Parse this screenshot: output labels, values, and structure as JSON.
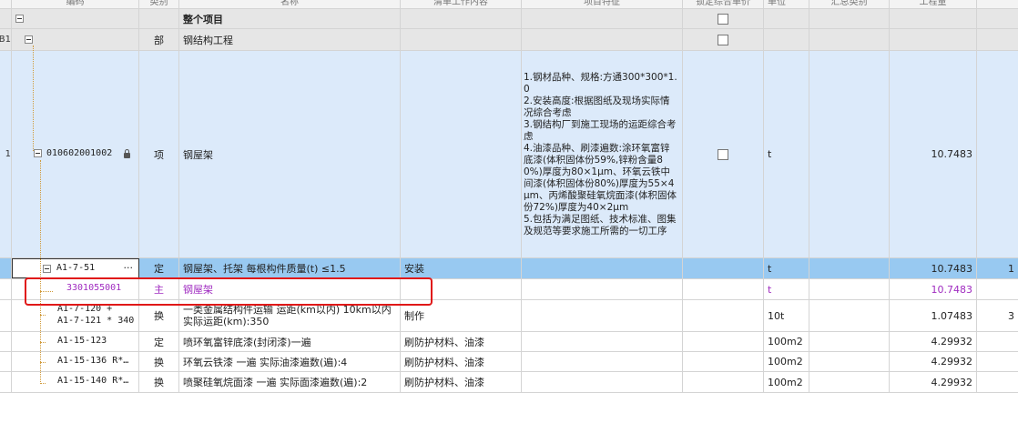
{
  "header": {
    "code": "编码",
    "type": "类别",
    "name": "名称",
    "content": "清单工作内容",
    "feature": "项目特征",
    "lock": "锁定综合单价",
    "unit": "单位",
    "spec": "汇总类别",
    "qty": "工程量"
  },
  "rows": [
    {
      "num": "",
      "code": "",
      "type": "",
      "name": "整个项目",
      "content": "",
      "feature": "",
      "unit": "",
      "qty": ""
    },
    {
      "num": "B1",
      "code": "",
      "type": "部",
      "name": "钢结构工程",
      "content": "",
      "feature": "",
      "unit": "",
      "qty": ""
    },
    {
      "num": "1",
      "code": "010602001002",
      "type": "项",
      "name": "钢屋架",
      "content": "",
      "feature": "1.钢材品种、规格:方通300*300*1.0\n2.安装高度:根据图纸及现场实际情况综合考虑\n3.钢结构厂到施工现场的运距综合考虑\n4.油漆品种、刷漆遍数:涂环氧富锌底漆(体积固体份59%,锌粉含量80%)厚度为80×1μm、环氧云铁中间漆(体积固体份80%)厚度为55×4μm、丙烯酸聚硅氧烷面漆(体积固体份72%)厚度为40×2μm\n5.包括为满足图纸、技术标准、图集及规范等要求施工所需的一切工序",
      "unit": "t",
      "qty": "10.7483"
    },
    {
      "num": "",
      "code": "A1-7-51",
      "type": "定",
      "name": "钢屋架、托架 每根构件质量(t) ≤1.5",
      "content": "安装",
      "feature": "",
      "unit": "t",
      "qty": "10.7483",
      "extra": "1"
    },
    {
      "num": "",
      "code": "3301055001",
      "type": "主",
      "name": "钢屋架",
      "content": "",
      "feature": "",
      "unit": "t",
      "qty": "10.7483"
    },
    {
      "num": "",
      "code": "A1-7-120 +\nA1-7-121 * 340",
      "type": "换",
      "name": "一类金属结构件运输 运距(km以内) 10km以内 实际运距(km):350",
      "content": "制作",
      "feature": "",
      "unit": "10t",
      "qty": "1.07483",
      "extra": "3"
    },
    {
      "num": "",
      "code": "A1-15-123",
      "type": "定",
      "name": "喷环氧富锌底漆(封闭漆)一遍",
      "content": "刷防护材料、油漆",
      "feature": "",
      "unit": "100m2",
      "qty": "4.29932"
    },
    {
      "num": "",
      "code": "A1-15-136 R*…",
      "type": "换",
      "name": "环氧云铁漆 一遍  实际油漆遍数(遍):4",
      "content": "刷防护材料、油漆",
      "feature": "",
      "unit": "100m2",
      "qty": "4.29932"
    },
    {
      "num": "",
      "code": "A1-15-140 R*…",
      "type": "换",
      "name": "喷聚硅氧烷面漆 一遍  实际面漆遍数(遍):2",
      "content": "刷防护材料、油漆",
      "feature": "",
      "unit": "100m2",
      "qty": "4.29932"
    }
  ],
  "colors": {
    "selected_row": "#98c9f1",
    "item_row": "#dceafa",
    "group_row": "#e6e6e6",
    "highlight_text": "#a02cc0",
    "annotation_box": "#e01818"
  },
  "icons": [
    "collapse-icon",
    "lock-icon",
    "checkbox",
    "more-icon"
  ]
}
